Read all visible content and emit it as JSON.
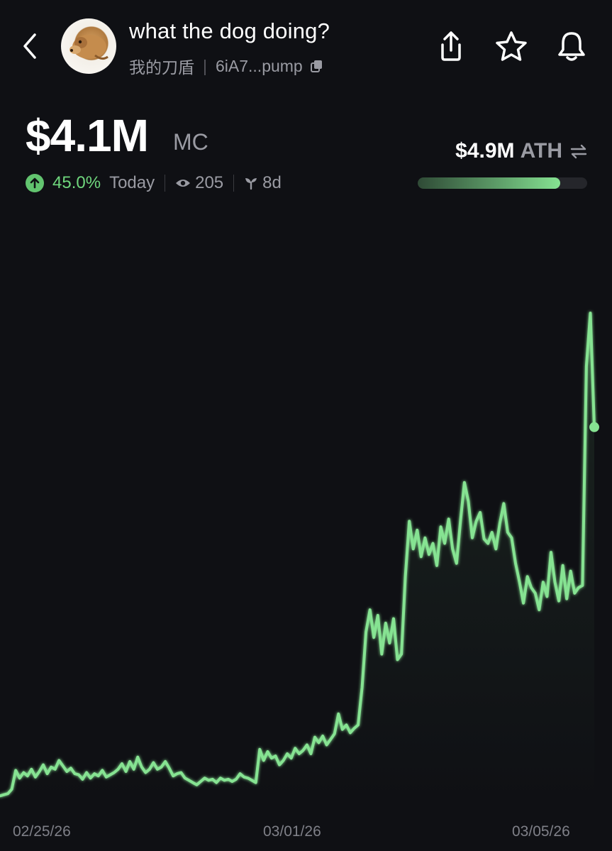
{
  "header": {
    "token_name": "what the dog doing?",
    "subtitle": "我的刀盾",
    "address": "6iA7...pump"
  },
  "market": {
    "mc_value": "$4.1M",
    "mc_label": "MC",
    "change_pct": "45.0%",
    "change_period": "Today",
    "views": "205",
    "age": "8d"
  },
  "ath": {
    "value": "$4.9M",
    "label": "ATH",
    "progress": 0.84
  },
  "colors": {
    "background": "#0f1014",
    "accent_green": "#86e392",
    "muted_text": "#9a9ba3"
  },
  "chart_data": {
    "type": "line",
    "x_ticks": [
      "02/25/26",
      "03/01/26",
      "03/05/26"
    ],
    "ylabel": "",
    "xlabel": "",
    "grid": false,
    "ylim": [
      0,
      5.0
    ],
    "series": [
      {
        "values": [
          0.12,
          0.13,
          0.14,
          0.18,
          0.35,
          0.28,
          0.33,
          0.3,
          0.36,
          0.29,
          0.34,
          0.4,
          0.32,
          0.38,
          0.36,
          0.44,
          0.39,
          0.34,
          0.37,
          0.32,
          0.31,
          0.27,
          0.33,
          0.28,
          0.32,
          0.3,
          0.35,
          0.29,
          0.31,
          0.33,
          0.36,
          0.41,
          0.34,
          0.43,
          0.36,
          0.47,
          0.38,
          0.33,
          0.36,
          0.42,
          0.36,
          0.38,
          0.43,
          0.37,
          0.3,
          0.32,
          0.33,
          0.28,
          0.26,
          0.24,
          0.22,
          0.25,
          0.28,
          0.26,
          0.27,
          0.24,
          0.28,
          0.26,
          0.27,
          0.25,
          0.27,
          0.32,
          0.29,
          0.28,
          0.26,
          0.24,
          0.54,
          0.44,
          0.52,
          0.46,
          0.48,
          0.4,
          0.44,
          0.5,
          0.46,
          0.55,
          0.5,
          0.53,
          0.58,
          0.5,
          0.65,
          0.6,
          0.66,
          0.58,
          0.63,
          0.68,
          0.86,
          0.72,
          0.76,
          0.69,
          0.73,
          0.76,
          1.1,
          1.6,
          1.8,
          1.55,
          1.75,
          1.4,
          1.68,
          1.5,
          1.72,
          1.35,
          1.4,
          2.1,
          2.6,
          2.35,
          2.52,
          2.28,
          2.45,
          2.3,
          2.4,
          2.2,
          2.55,
          2.4,
          2.62,
          2.35,
          2.22,
          2.6,
          2.95,
          2.78,
          2.45,
          2.6,
          2.68,
          2.44,
          2.4,
          2.5,
          2.35,
          2.58,
          2.76,
          2.5,
          2.45,
          2.22,
          2.05,
          1.86,
          2.1,
          2.0,
          1.95,
          1.8,
          2.05,
          1.92,
          2.32,
          2.05,
          1.88,
          2.2,
          1.9,
          2.15,
          1.95,
          2.0,
          2.02,
          4.0,
          4.48,
          3.45
        ]
      }
    ]
  }
}
